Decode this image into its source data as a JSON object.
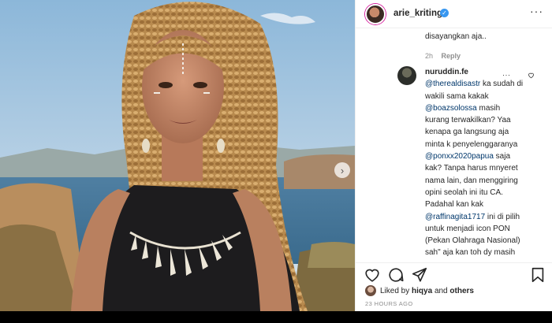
{
  "post": {
    "username": "arie_kriting",
    "verified": true
  },
  "previous_comment": {
    "text": "disayangkan aja..",
    "age": "2h",
    "reply_label": "Reply"
  },
  "comment": {
    "username": "nuruddin.fe",
    "segments": [
      {
        "text": "@therealdisastr",
        "mention": true
      },
      {
        "text": " ka sudah di wakili sama kakak ",
        "mention": false
      },
      {
        "text": "@boazsolossa",
        "mention": true
      },
      {
        "text": " masih kurang terwakilkan? Yaa kenapa ga langsung aja minta k penyelenggaranya ",
        "mention": false
      },
      {
        "text": "@ponxx2020papua",
        "mention": true
      },
      {
        "text": " saja kak? Tanpa harus mnyeret nama lain, dan menggiring opini seolah ini itu CA. Padahal kan kak ",
        "mention": false
      },
      {
        "text": "@raffinagita1717",
        "mention": true
      },
      {
        "text": " ini di pilih untuk menjadi icon PON (Pekan Olahraga Nasional) sah\" aja kan toh dy masih",
        "mention": false
      }
    ]
  },
  "likes": {
    "prefix": "Liked by",
    "user": "hiqya",
    "connector": "and",
    "others": "others"
  },
  "timestamp": "23 HOURS AGO",
  "icons": {
    "heart": "heart-icon",
    "comment": "comment-icon",
    "share": "share-icon",
    "save": "bookmark-icon",
    "next": "chevron-right-icon"
  },
  "colors": {
    "verified": "#3897f0",
    "mention": "#00376b",
    "meta": "#8e8e8e"
  }
}
